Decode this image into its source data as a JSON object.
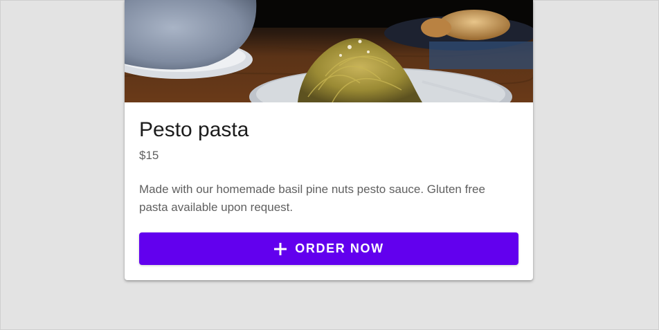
{
  "card": {
    "image": {
      "icon": "pesto-pasta-photo"
    },
    "title": "Pesto pasta",
    "price": "$15",
    "description": "Made with our homemade basil pine nuts pesto sauce. Gluten free pasta available upon request.",
    "order_button": {
      "label": "ORDER NOW",
      "icon": "plus-icon"
    }
  },
  "colors": {
    "background": "#e3e3e3",
    "card": "#ffffff",
    "primary": "#6200ee",
    "title_text": "#1c1c1c",
    "secondary_text": "#5f5f5f"
  }
}
